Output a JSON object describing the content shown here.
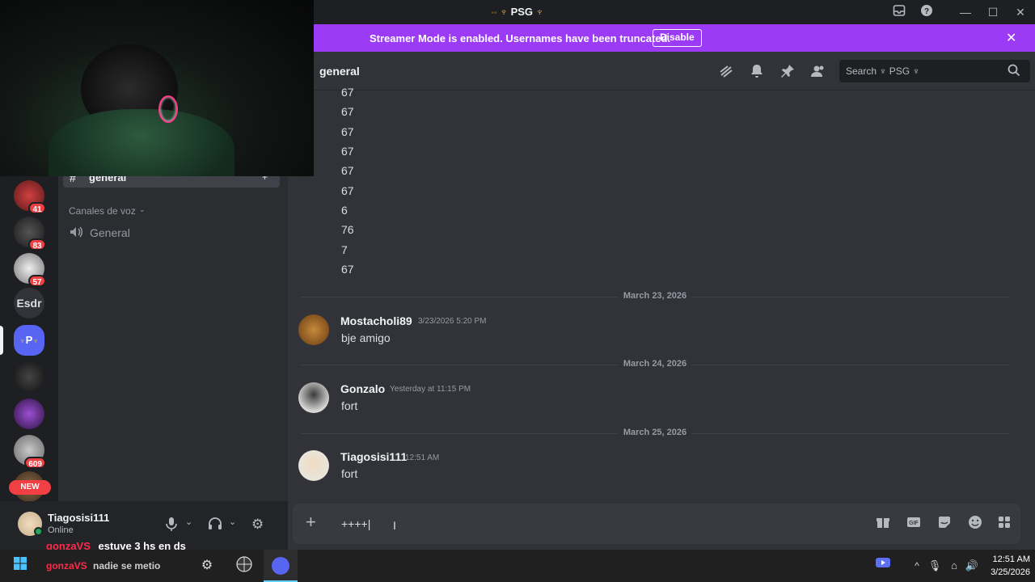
{
  "window": {
    "title": "PSG",
    "title_glyph_left": "♆",
    "title_glyph_right": "♆"
  },
  "banner": {
    "text": "Streamer Mode is enabled. Usernames have been truncated.",
    "disable_label": "Disable"
  },
  "header": {
    "channel_name": "general",
    "search_placeholder": "Search ♆ PSG ♆"
  },
  "sidebar": {
    "current_channel": "general",
    "voice_category": "Canales de voz",
    "voice_channel": "General"
  },
  "servers": [
    {
      "badge": "41",
      "color": "#7a2b2b"
    },
    {
      "badge": "83",
      "color": "#3a3a3a"
    },
    {
      "badge": "57",
      "color": "#d9d9d9"
    },
    {
      "label": "Esdr",
      "color": "#313338"
    },
    {
      "label": "P",
      "color": "#5865f2"
    },
    {
      "color": "#2a2a2a"
    },
    {
      "color": "#6b2b9e"
    },
    {
      "badge": "609",
      "color": "#9a9a9a"
    },
    {
      "new_label": "NEW",
      "color": "#5a3a2a"
    }
  ],
  "messages": {
    "number_lines": [
      "67",
      "67",
      "67",
      "67",
      "67",
      "67",
      "6",
      "76",
      "7",
      "67"
    ],
    "groups": [
      {
        "date": "March 23, 2026",
        "author": "Mostacholi89",
        "timestamp": "3/23/2026 5:20 PM",
        "text": "bje amigo"
      },
      {
        "date": "March 24, 2026",
        "author": "Gonzalo",
        "timestamp": "Yesterday at 11:15 PM",
        "text": "fort"
      },
      {
        "date": "March 25, 2026",
        "author": "Tiagosisi111",
        "timestamp": "12:51 AM",
        "text": "fort"
      }
    ]
  },
  "composer": {
    "value": "++++|"
  },
  "user_panel": {
    "username": "Tiagosisi111",
    "status": "Online"
  },
  "overlay_chat": {
    "user": "gonzaVS",
    "text": "estuve 3 hs en ds",
    "user2": "gonzaVS",
    "text2": "nadie se metio"
  },
  "taskbar": {
    "time": "12:51 AM",
    "date": "3/25/2026"
  }
}
